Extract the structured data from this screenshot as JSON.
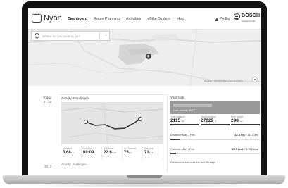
{
  "header": {
    "logo_text": "Nyon",
    "nav": [
      "Dashboard",
      "Route Planning",
      "Activities",
      "eBike System",
      "Help"
    ],
    "active_nav": "Dashboard",
    "profile_label": "Profile",
    "brand": "BOSCH",
    "brand_tagline": "Invented for life"
  },
  "map": {
    "search_placeholder": "Where do you want to go?",
    "copyright": "Map data © OpenStreetMap contributors, Terms"
  },
  "timeline": {
    "today_label": "Today",
    "today_time": "07:16",
    "prev_time": "2017"
  },
  "activity": {
    "title": "Activity: Reutlingen",
    "stats": [
      {
        "label": "Distance",
        "value": "3.68",
        "unit": "km"
      },
      {
        "label": "Duration",
        "value": "00:09",
        "unit": "h"
      },
      {
        "label": "Ø Speed",
        "value": "22.6",
        "unit": "km/h"
      },
      {
        "label": "Ø Cadence",
        "value": "75",
        "unit": "rpm"
      },
      {
        "label": "Calories",
        "value": "71",
        "unit": "kcal"
      }
    ],
    "next_activity": "Activity: Reutlingen"
  },
  "your_stats": {
    "title": "Your stats",
    "last_activity_label": "Last activity",
    "last_activity_year": "2017",
    "totals": [
      {
        "label": "Total distance",
        "value": "2115",
        "unit": "km"
      },
      {
        "label": "Total elevation",
        "value": "27029",
        "unit": "m"
      },
      {
        "label": "Best month",
        "value": "298",
        "unit": "km"
      }
    ],
    "distance_label": "Distance",
    "distance_period": "Mar. / Feb.",
    "distance_value": "12.4 km",
    "distance_of": "/ 111.3 km",
    "distance_fraction": 0.11,
    "calories_label": "Calories",
    "calories_period": "Mar. / Feb.",
    "calories_value": "207 kcal",
    "calories_of": "/ 3,752 kcal",
    "calories_fraction": 0.06,
    "distance_30_label": "Distance in km over the last 30 days"
  },
  "colors": {
    "accent": "#444444",
    "panel": "#999999"
  }
}
